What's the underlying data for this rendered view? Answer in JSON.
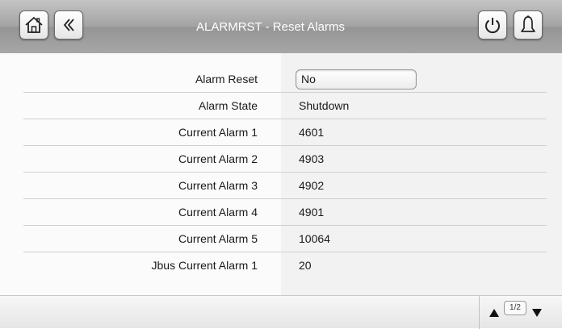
{
  "header": {
    "title": "ALARMRST - Reset Alarms",
    "buttons": {
      "home": "home-icon",
      "back": "back-icon",
      "power": "power-icon",
      "alarm": "bell-icon"
    }
  },
  "rows": [
    {
      "label": "Alarm Reset",
      "value": "No"
    },
    {
      "label": "Alarm State",
      "value": "Shutdown"
    },
    {
      "label": "Current Alarm 1",
      "value": "4601"
    },
    {
      "label": "Current Alarm 2",
      "value": "4903"
    },
    {
      "label": "Current Alarm 3",
      "value": "4902"
    },
    {
      "label": "Current Alarm 4",
      "value": "4901"
    },
    {
      "label": "Current Alarm 5",
      "value": "10064"
    },
    {
      "label": "Jbus Current Alarm 1",
      "value": "20"
    }
  ],
  "footer": {
    "page_indicator": "1/2"
  }
}
